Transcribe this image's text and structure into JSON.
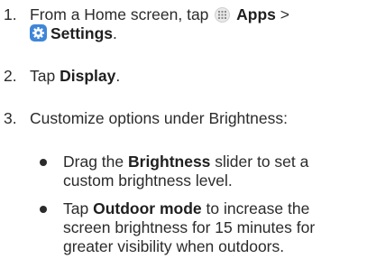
{
  "steps": [
    {
      "number": "1.",
      "part1": "From a Home screen, tap",
      "apps_label": "Apps",
      "sep": ">",
      "settings_label": "Settings",
      "end": "."
    },
    {
      "number": "2.",
      "part1": "Tap",
      "display_label": "Display",
      "end": "."
    },
    {
      "number": "3.",
      "text": "Customize options under Brightness:"
    }
  ],
  "bullets": [
    {
      "pre": "Drag the",
      "bold": "Brightness",
      "line1_rest": "slider to set a",
      "line2": "custom brightness level."
    },
    {
      "pre": "Tap",
      "bold": "Outdoor mode",
      "line1_rest": "to increase the",
      "line2": "screen brightness for 15 minutes for",
      "line3": "greater visibility when outdoors."
    }
  ],
  "icons": {
    "apps": "apps-grid-icon",
    "settings": "settings-gear-icon",
    "settings_color": "#3f86d8"
  }
}
